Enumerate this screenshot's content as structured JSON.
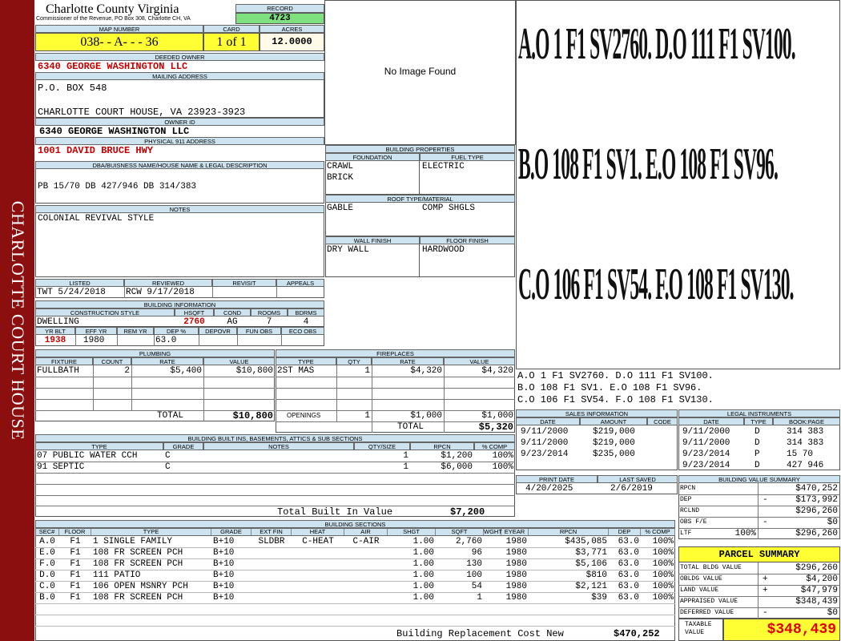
{
  "side_title": "CHARLOTTE COURT HOUSE",
  "county": "Charlotte County Virginia",
  "commissioner": "Commissioner of the Revenue, PO Box 308, Charlotte CH, VA",
  "record": {
    "label": "RECORD",
    "value": "4723"
  },
  "map": {
    "label": "MAP NUMBER",
    "value": "038- - A- - - 36"
  },
  "card": {
    "label": "CARD",
    "value": "1 of 1"
  },
  "acres": {
    "label": "ACRES",
    "value": "12.0000"
  },
  "deeded_owner": {
    "label": "DEEDED OWNER",
    "value": "6340 GEORGE WASHINGTON LLC"
  },
  "mailing": {
    "label": "MAILING ADDRESS",
    "line1": "P.O. BOX 548",
    "line2": "CHARLOTTE COURT HOUSE, VA 23923-3923"
  },
  "owner_id": {
    "label": "OWNER ID",
    "value": "6340 GEORGE WASHINGTON LLC"
  },
  "physical": {
    "label": "PHYSICAL 911 ADDRESS",
    "value": "1001 DAVID BRUCE HWY"
  },
  "dba": {
    "label": "DBA/BUISNESS NAME/HOUSE NAME & LEGAL DESCRIPTION",
    "value": "PB 15/70 DB 427/946 DB 314/383"
  },
  "notes": {
    "label": "NOTES",
    "value": "COLONIAL REVIVAL STYLE"
  },
  "image": {
    "text": "No Image Found"
  },
  "listing": {
    "listed_label": "LISTED",
    "reviewed_label": "REVIEWED",
    "revisit_label": "REVISIT",
    "appeals_label": "APPEALS",
    "listed": "TWT  5/24/2018",
    "reviewed": "RCW  9/17/2018"
  },
  "building_info": {
    "label": "BUILDING INFORMATION",
    "style_label": "CONSTRUCTION STYLE",
    "hsqft_label": "HSQFT",
    "cond_label": "COND",
    "rooms_label": "ROOMS",
    "bdrms_label": "BDRMS",
    "style": "DWELLING",
    "hsqft": "2760",
    "cond": "AG",
    "rooms": "7",
    "bdrms": "4",
    "yrblt_label": "YR BLT",
    "effyr_label": "EFF YR",
    "remyr_label": "REM YR",
    "dep_label": "DEP %",
    "depovr_label": "DEPOVR",
    "funobs_label": "FUN OBS",
    "ecoobs_label": "ECO OBS",
    "yrblt": "1938",
    "effyr": "1980",
    "dep": "63.0"
  },
  "building_props": {
    "label": "BUILDING PROPERTIES",
    "foundation_label": "FOUNDATION",
    "fuel_label": "FUEL TYPE",
    "foundation1": "CRAWL",
    "foundation2": "BRICK",
    "fuel": "ELECTRIC",
    "roof_label": "ROOF TYPE/MATERIAL",
    "roof1": "GABLE",
    "roof2": "COMP SHGLS",
    "wall_label": "WALL FINISH",
    "floor_label": "FLOOR FINISH",
    "wall": "DRY WALL",
    "floor": "HARDWOOD"
  },
  "sketch": {
    "rows": [
      "A.O  1   F1  SV2760.   D.O  111  F1  SV100.",
      "B.O  108  F1  SV1.     E.O  108  F1  SV96.",
      "C.O  106  F1  SV54.    F.O  108  F1  SV130."
    ]
  },
  "sketch_legend": [
    "A.O   1    F1   SV2760.    D.O   111   F1   SV100.",
    "B.O   108  F1   SV1.       E.O   108   F1   SV96.",
    "C.O   106  F1   SV54.      F.O   108   F1   SV130."
  ],
  "plumbing": {
    "label": "PLUMBING",
    "headers": [
      "FIXTURE",
      "COUNT",
      "RATE",
      "VALUE"
    ],
    "rows": [
      {
        "fixture": "FULLBATH",
        "count": "2",
        "rate": "$5,400",
        "value": "$10,800"
      }
    ],
    "total_label": "TOTAL",
    "total": "$10,800"
  },
  "fireplaces": {
    "label": "FIREPLACES",
    "headers": [
      "TYPE",
      "QTY",
      "RATE",
      "VALUE"
    ],
    "rows": [
      {
        "type": "2ST MAS",
        "qty": "1",
        "rate": "$4,320",
        "value": "$4,320"
      }
    ],
    "openings_label": "OPENINGS",
    "openings_qty": "1",
    "openings_rate": "$1,000",
    "openings_value": "$1,000",
    "total_label": "TOTAL",
    "total": "$5,320"
  },
  "sales": {
    "label": "SALES INFORMATION",
    "headers": [
      "DATE",
      "AMOUNT",
      "CODE"
    ],
    "rows": [
      [
        "9/11/2000",
        "$219,000",
        ""
      ],
      [
        "9/11/2000",
        "$219,000",
        ""
      ],
      [
        "9/23/2014",
        "$235,000",
        ""
      ]
    ]
  },
  "legal": {
    "label": "LEGAL INSTRUMENTS",
    "headers": [
      "DATE",
      "TYPE",
      "BOOK:PAGE"
    ],
    "rows": [
      [
        "9/11/2000",
        "D",
        "314 383"
      ],
      [
        "9/11/2000",
        "D",
        "314 383"
      ],
      [
        "9/23/2014",
        "P",
        "15 70"
      ],
      [
        "9/23/2014",
        "D",
        "427 946"
      ]
    ]
  },
  "builtins": {
    "label": "BUILDING BUILT INS, BASEMENTS, ATTICS & SUB SECTIONS",
    "headers": [
      "TYPE",
      "GRADE",
      "NOTES",
      "QTY/SIZE",
      "RPCN",
      "% COMP"
    ],
    "rows": [
      [
        "07 PUBLIC WATER CCH",
        "C",
        "",
        "1",
        "$1,200",
        "100%"
      ],
      [
        "91 SEPTIC",
        "C",
        "",
        "1",
        "$6,000",
        "100%"
      ]
    ],
    "total_label": "Total Built In Value",
    "total": "$7,200"
  },
  "print": {
    "print_label": "PRINT DATE",
    "saved_label": "LAST SAVED",
    "print_date": "4/20/2025",
    "last_saved": "2/6/2019"
  },
  "value_summary": {
    "label": "BUILDING VALUE SUMMARY",
    "rows": [
      {
        "k": "RPCN",
        "op": "",
        "v": "$470,252"
      },
      {
        "k": "DEP",
        "op": "-",
        "v": "$173,992"
      },
      {
        "k": "RCLND",
        "op": "",
        "v": "$296,260"
      },
      {
        "k": "OBS F/E",
        "op": "-",
        "v": "$0"
      },
      {
        "k": "LTF",
        "pct": "100%",
        "op": "",
        "v": "$296,260"
      }
    ]
  },
  "sections": {
    "label": "BUILDING SECTIONS",
    "headers": [
      "SEC#",
      "FLOOR",
      "TYPE",
      "GRADE",
      "EXT FIN",
      "HEAT",
      "AIR",
      "SHGT",
      "SQFT",
      "WGHT",
      "EYEAR",
      "RPCN",
      "DEP",
      "% COMP"
    ],
    "rows": [
      [
        "A.0",
        "F1",
        "1 SINGLE FAMILY",
        "B+10",
        "SLDBR",
        "C-HEAT",
        "C-AIR",
        "1.00",
        "2,760",
        "",
        "1980",
        "$435,085",
        "63.0",
        "100%"
      ],
      [
        "E.0",
        "F1",
        "108 FR SCREEN PCH",
        "B+10",
        "",
        "",
        "",
        "1.00",
        "96",
        "",
        "1980",
        "$3,771",
        "63.0",
        "100%"
      ],
      [
        "F.0",
        "F1",
        "108 FR SCREEN PCH",
        "B+10",
        "",
        "",
        "",
        "1.00",
        "130",
        "",
        "1980",
        "$5,106",
        "63.0",
        "100%"
      ],
      [
        "D.0",
        "F1",
        "111 PATIO",
        "B+10",
        "",
        "",
        "",
        "1.00",
        "100",
        "",
        "1980",
        "$810",
        "63.0",
        "100%"
      ],
      [
        "C.0",
        "F1",
        "106 OPEN MSNRY PCH",
        "B+10",
        "",
        "",
        "",
        "1.00",
        "54",
        "",
        "1980",
        "$2,121",
        "63.0",
        "100%"
      ],
      [
        "B.0",
        "F1",
        "108 FR SCREEN PCH",
        "B+10",
        "",
        "",
        "",
        "1.00",
        "1",
        "",
        "1980",
        "$39",
        "63.0",
        "100%"
      ]
    ],
    "replacement_label": "Building Replacement Cost New",
    "replacement": "$470,252"
  },
  "parcel": {
    "label": "PARCEL SUMMARY",
    "rows": [
      {
        "k": "TOTAL BLDG VALUE",
        "op": "",
        "v": "$296,260"
      },
      {
        "k": "OBLDG VALUE",
        "op": "+",
        "v": "$4,200"
      },
      {
        "k": "LAND VALUE",
        "op": "+",
        "v": "$47,979"
      },
      {
        "k": "APPRAISED VALUE",
        "op": "",
        "v": "$348,439"
      },
      {
        "k": "DEFERRED VALUE",
        "op": "-",
        "v": "$0"
      }
    ],
    "taxable_label1": "TAXABLE",
    "taxable_label2": "VALUE",
    "taxable": "$348,439"
  }
}
